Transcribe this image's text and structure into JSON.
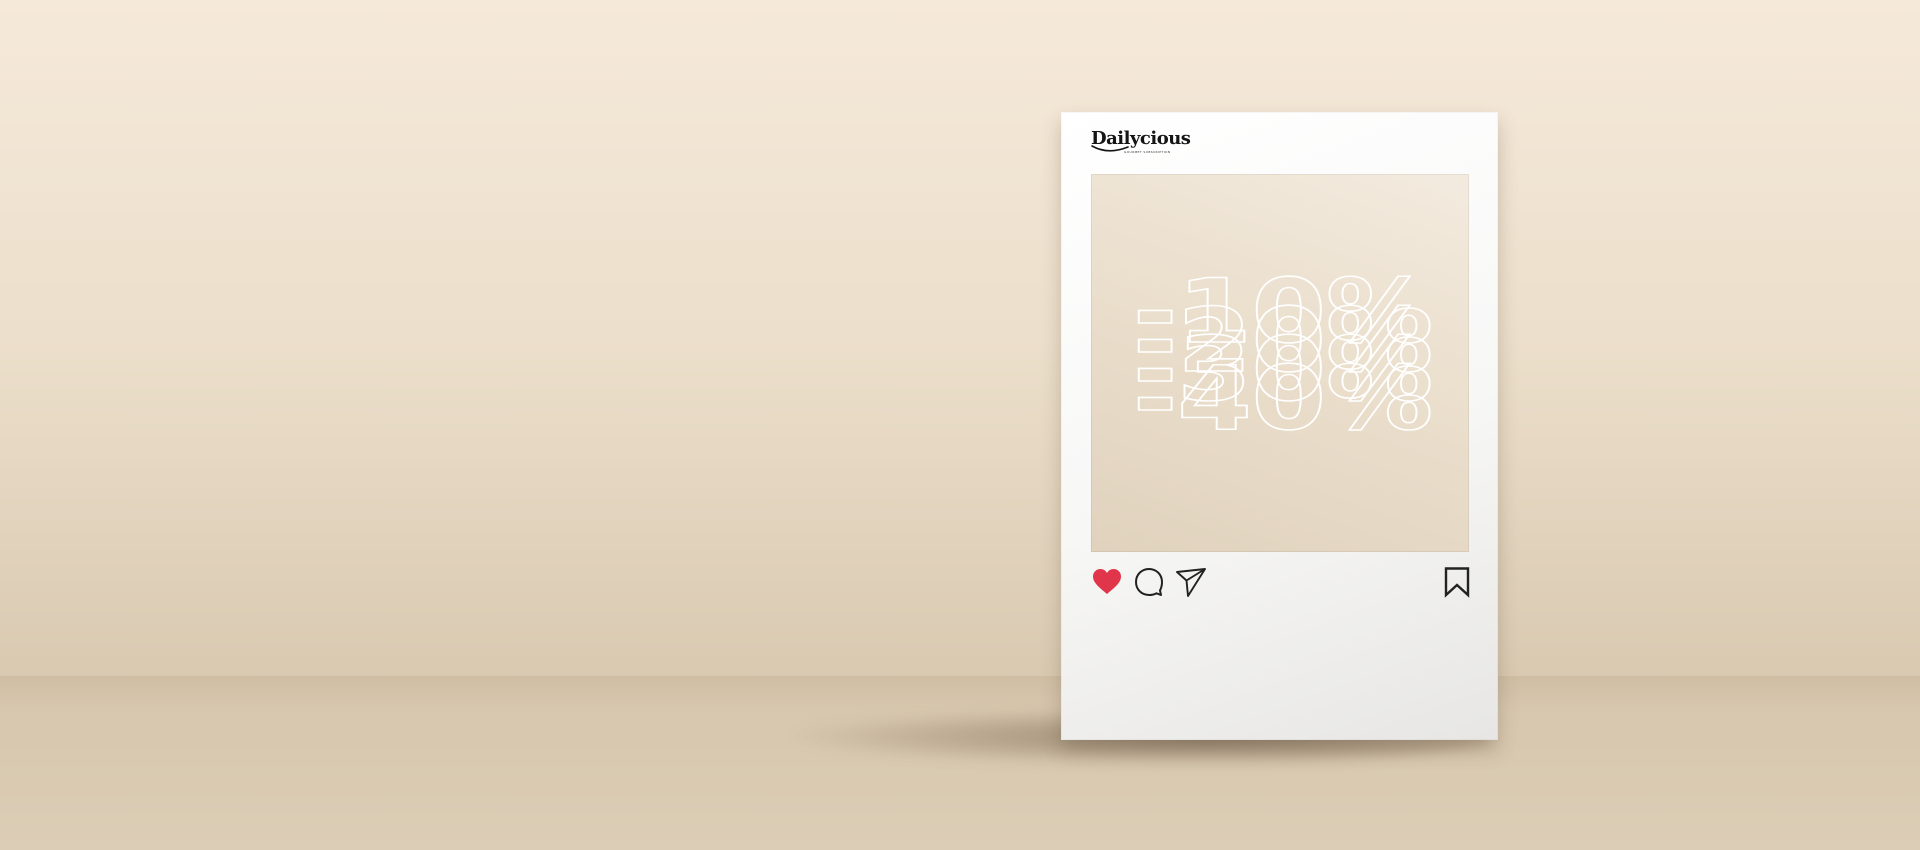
{
  "scene": {
    "background_color": "#ecdfcb",
    "floor_color": "#d5c3a9"
  },
  "post": {
    "brand": {
      "name": "Dailycious",
      "tagline": "GOURMET SUBSCRIPTION"
    },
    "artwork": {
      "discount_values": [
        "-10%",
        "-20%",
        "-30%",
        "-40%"
      ],
      "outline_color": "#ffffff"
    },
    "actions": {
      "like_icon": "heart-icon",
      "like_color": "#e0354a",
      "comment_icon": "comment-bubble-icon",
      "share_icon": "paper-plane-icon",
      "save_icon": "bookmark-icon",
      "icon_color": "#222222"
    }
  }
}
